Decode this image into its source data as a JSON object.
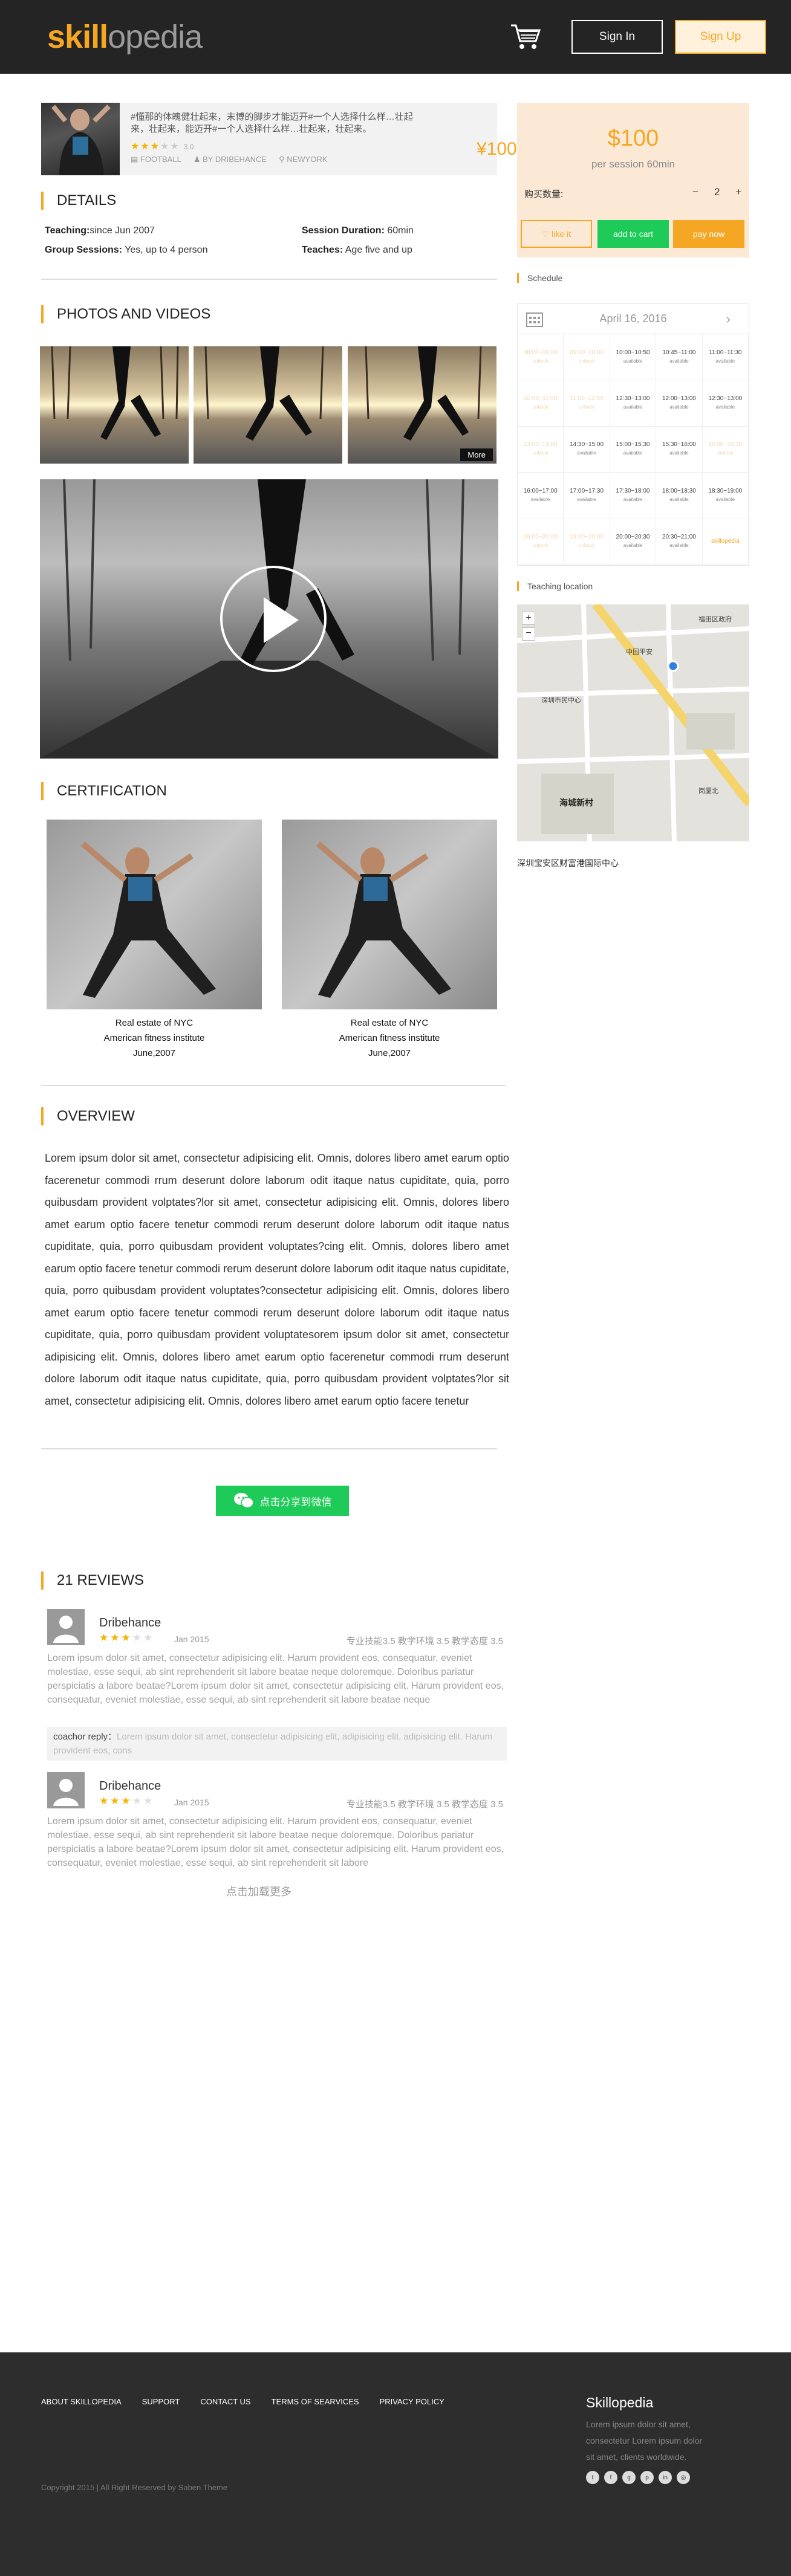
{
  "header": {
    "logo_a": "skill",
    "logo_b": "opedia",
    "signin": "Sign In",
    "signup": "Sign Up"
  },
  "profile": {
    "intro": "#懂那的体魄健壮起来，末博的脚步才能迈开#一个人选择什么样…壮起来，壮起来，能迈开#一个人选择什么样…壮起来，壮起来。",
    "rating": "3.0",
    "category": "FOOTBALL",
    "author": "BY DRIBEHANCE",
    "location": "NEWYORK",
    "price": "¥100"
  },
  "details": {
    "title": "DETAILS",
    "teaching_k": "Teaching:",
    "teaching_v": "since Jun 2007",
    "duration_k": "Session Duration:",
    "duration_v": "60min",
    "group_k": "Group Sessions:",
    "group_v": "Yes, up to 4 person",
    "teaches_k": "Teaches:",
    "teaches_v": "Age five and up"
  },
  "photos": {
    "title": "PHOTOS AND VIDEOS",
    "more": "More"
  },
  "certification": {
    "title": "CERTIFICATION",
    "items": [
      {
        "line1": "Real estate of NYC",
        "line2": "American fitness institute",
        "line3": "June,2007"
      },
      {
        "line1": "Real estate of NYC",
        "line2": "American fitness institute",
        "line3": "June,2007"
      }
    ]
  },
  "overview": {
    "title": "OVERVIEW",
    "text": "Lorem ipsum dolor sit amet, consectetur adipisicing elit. Omnis, dolores libero amet earum optio facerenetur commodi rrum deserunt dolore laborum odit itaque natus cupiditate, quia, porro quibusdam provident volptates?lor sit amet, consectetur adipisicing elit. Omnis, dolores libero amet earum optio facere tenetur commodi rerum deserunt dolore laborum odit itaque natus cupiditate, quia, porro quibusdam provident voluptates?cing elit. Omnis, dolores libero amet earum optio facere tenetur commodi rerum deserunt dolore laborum odit itaque natus cupiditate, quia, porro quibusdam provident voluptates?consectetur adipisicing elit. Omnis, dolores libero amet earum optio facere tenetur commodi rerum deserunt dolore laborum odit itaque natus cupiditate, quia, porro quibusdam provident voluptatesorem ipsum dolor sit amet, consectetur adipisicing elit. Omnis, dolores libero amet earum optio facerenetur commodi rrum deserunt dolore laborum odit itaque natus cupiditate, quia, porro quibusdam provident volptates?lor sit amet, consectetur adipisicing elit. Omnis, dolores libero amet earum optio facere tenetur",
    "share": "点击分享到微信"
  },
  "reviews": {
    "title": "21 REVIEWS",
    "items": [
      {
        "name": "Dribehance",
        "date": "Jan 2015",
        "score": "专业技能3.5 教学环境 3.5 教学态度 3.5",
        "body": "Lorem ipsum dolor sit amet, consectetur adipisicing elit. Harum provident eos, consequatur, eveniet molestiae, esse sequi, ab sint reprehenderit sit labore beatae neque doloremque. Doloribus pariatur perspiciatis a labore beatae?Lorem ipsum dolor sit amet, consectetur adipisicing elit. Harum provident eos, consequatur, eveniet molestiae, esse sequi, ab sint reprehenderit sit labore beatae neque",
        "reply_k": "coachor reply：",
        "reply_v": "Lorem ipsum dolor sit amet, consectetur adipisicing elit, adipisicing elit, adipisicing elit. Harum provident eos, cons"
      },
      {
        "name": "Dribehance",
        "date": "Jan 2015",
        "score": "专业技能3.5 教学环境 3.5 教学态度 3.5",
        "body": "Lorem ipsum dolor sit amet, consectetur adipisicing elit. Harum provident eos, consequatur, eveniet molestiae, esse sequi, ab sint reprehenderit sit labore beatae neque doloremque. Doloribus pariatur perspiciatis a labore beatae?Lorem ipsum dolor sit amet, consectetur adipisicing elit. Harum provident eos, consequatur, eveniet molestiae, esse sequi, ab sint reprehenderit sit labore"
      }
    ],
    "load_more": "点击加载更多"
  },
  "sidebar": {
    "price": "$100",
    "per": "per session 60min",
    "qty_label": "购买数量:",
    "qty_minus": "−",
    "qty_value": "2",
    "qty_plus": "+",
    "like": "like it",
    "add_to_cart": "add to cart",
    "pay_now": "pay now",
    "schedule_title": "Schedule",
    "date": "April 16, 2016",
    "slots": [
      {
        "t": "08:00~09:00",
        "s": "unbook",
        "on": false
      },
      {
        "t": "09:00~10:00",
        "s": "unbook",
        "on": false
      },
      {
        "t": "10:00~10:50",
        "s": "available",
        "on": true
      },
      {
        "t": "10:45~11:00",
        "s": "available",
        "on": true
      },
      {
        "t": "11:00~11:30",
        "s": "available",
        "on": true
      },
      {
        "t": "10:00~11:00",
        "s": "unbook",
        "on": false
      },
      {
        "t": "11:00~12:00",
        "s": "unbook",
        "on": false
      },
      {
        "t": "12:30~13:00",
        "s": "available",
        "on": true
      },
      {
        "t": "12:00~13:00",
        "s": "available",
        "on": true
      },
      {
        "t": "12:30~13:00",
        "s": "available",
        "on": true
      },
      {
        "t": "13:00~14:00",
        "s": "unbook",
        "on": false
      },
      {
        "t": "14:30~15:00",
        "s": "available",
        "on": true
      },
      {
        "t": "15:00~15:30",
        "s": "available",
        "on": true
      },
      {
        "t": "15:30~16:00",
        "s": "available",
        "on": true
      },
      {
        "t": "16:00~16:30",
        "s": "unbook",
        "on": false
      },
      {
        "t": "16:00~17:00",
        "s": "available",
        "on": true
      },
      {
        "t": "17:00~17:30",
        "s": "available",
        "on": true
      },
      {
        "t": "17:30~18:00",
        "s": "available",
        "on": true
      },
      {
        "t": "18:00~18:30",
        "s": "available",
        "on": true
      },
      {
        "t": "18:30~19:00",
        "s": "available",
        "on": true
      },
      {
        "t": "19:00~20:00",
        "s": "unbook",
        "on": false
      },
      {
        "t": "19:00~20:00",
        "s": "unbook",
        "on": false
      },
      {
        "t": "20:00~20:30",
        "s": "available",
        "on": true
      },
      {
        "t": "20:30~21:00",
        "s": "available",
        "on": true
      },
      {
        "t": "skillopedia",
        "s": "",
        "on": true
      }
    ],
    "location_title": "Teaching location",
    "map_labels": [
      "福田区政府",
      "中国平安",
      "深圳市民中心",
      "海城新村",
      "岗厦北"
    ],
    "address": "深圳宝安区财富港国际中心"
  },
  "footer": {
    "nav": [
      "ABOUT SKILLOPEDIA",
      "SUPPORT",
      "CONTACT US",
      "TERMS OF SEARVICES",
      "PRIVACY POLICY"
    ],
    "copyright": "Copyright 2015 | All Right Reserved by Saben Theme",
    "brand": "Skillopedia",
    "desc": "Lorem ipsum dolor sit amet, consectetur Lorem ipsum dolor sit amet,  clients worldwide.",
    "social": [
      "t",
      "f",
      "g",
      "p",
      "in",
      "◎"
    ]
  },
  "colors": {
    "accent": "#f5a623",
    "green": "#1ecb58",
    "dark": "#242424"
  }
}
